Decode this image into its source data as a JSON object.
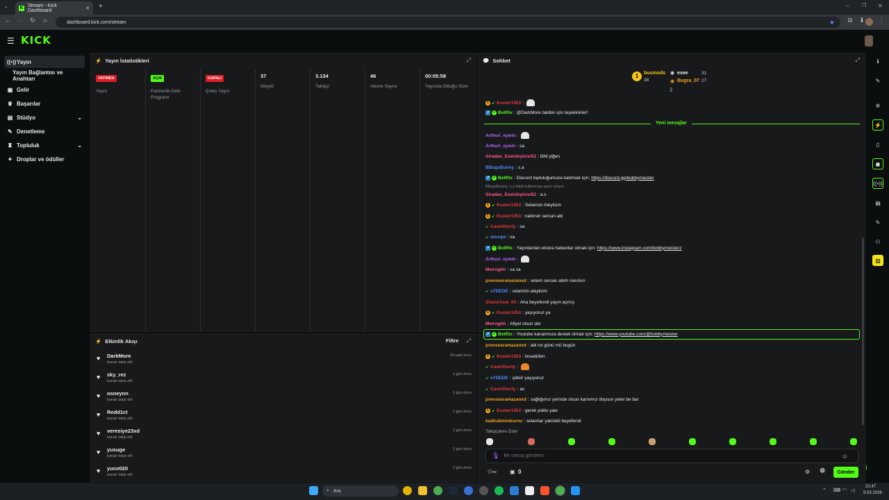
{
  "browser": {
    "tab_title": "Stream - Kick Dashboard",
    "url": "dashboard.kick.com/stream"
  },
  "app": {
    "logo": "KICK"
  },
  "sidebar": {
    "items": [
      {
        "icon": "broadcast-icon",
        "label": "Yayın"
      },
      {
        "icon": "",
        "label": "Yayın Bağlantısı ve Anahtarı"
      },
      {
        "icon": "wallet-icon",
        "label": "Gelir"
      },
      {
        "icon": "trophy-icon",
        "label": "Başarılar"
      },
      {
        "icon": "studio-icon",
        "label": "Stüdyo"
      },
      {
        "icon": "wrench-icon",
        "label": "Denetleme"
      },
      {
        "icon": "community-icon",
        "label": "Topluluk"
      },
      {
        "icon": "gift-icon",
        "label": "Droplar ve ödüller"
      }
    ]
  },
  "stats": {
    "title": "Yayın İstatistikleri",
    "columns": [
      {
        "value": "YAYINDA",
        "label": "Yayın",
        "kind": "badge-red"
      },
      {
        "value": "AÇIK",
        "label": "Partnerlik Gelir Programı",
        "kind": "badge-green"
      },
      {
        "value": "KAPALI",
        "label": "Çoklu Yayın",
        "kind": "badge-red"
      },
      {
        "value": "37",
        "label": "İzleyici",
        "kind": "num"
      },
      {
        "value": "3.134",
        "label": "Takipçi",
        "kind": "num"
      },
      {
        "value": "46",
        "label": "Abone Sayısı",
        "kind": "num"
      },
      {
        "value": "00:05:58",
        "label": "Yayında Olduğu Süre",
        "kind": "num"
      }
    ]
  },
  "activity": {
    "title": "Etkinlik Akışı",
    "filter_label": "Filtre",
    "items": [
      {
        "name": "DarkMore",
        "sub": "kanalı takip etti",
        "time": "19 saat önce"
      },
      {
        "name": "sky_rez",
        "sub": "kanalı takip etti",
        "time": "1 gün önce"
      },
      {
        "name": "osneynn",
        "sub": "kanalı takip etti",
        "time": "1 gün önce"
      },
      {
        "name": "Redd1ct",
        "sub": "kanalı takip etti",
        "time": "1 gün önce"
      },
      {
        "name": "veresiye23xd",
        "sub": "kanalı takip etti",
        "time": "1 gün önce"
      },
      {
        "name": "yusuge",
        "sub": "kanalı takip etti",
        "time": "1 gün önce"
      },
      {
        "name": "yuco020",
        "sub": "kanalı takip etti",
        "time": "1 gün önce"
      }
    ]
  },
  "chat": {
    "title": "Sohbet",
    "top_gifters": [
      {
        "name": "busmods",
        "count": "38"
      },
      {
        "name": "exee",
        "count": "31"
      },
      {
        "name": "Bugra_07",
        "count": "27"
      }
    ],
    "new_messages_label": "Yeni mesajlar",
    "reply_note": "BBugsBunny: s.a ikinil kullanıcıya yanıt veriyor",
    "messages": [
      {
        "user": "Kuster1453",
        "color": "#e33b3b",
        "text": "",
        "emote": true
      },
      {
        "user": "BotRix",
        "color": "#53fc18",
        "text": "@DarkMore takibin için teşekkürler!"
      },
      {
        "user": "Arthuri_eywin",
        "color": "#b36bff",
        "text": "",
        "emote": true
      },
      {
        "user": "Arthuri_eywin",
        "color": "#b36bff",
        "text": "sa"
      },
      {
        "user": "Siradan_Exelzleyicisi52",
        "color": "#ff5c8a",
        "text": "Bitti yiğen"
      },
      {
        "user": "BBugsBunny",
        "color": "#4f8cff",
        "text": "s.a"
      },
      {
        "user": "BotRix",
        "color": "#53fc18",
        "text": "Discord topluluğumuza katılmak için;",
        "link": "https://discord.gg/bobbymeister"
      },
      {
        "user": "Siradan_Exelzleyicisi52",
        "color": "#ff5c8a",
        "text": "a.s"
      },
      {
        "user": "Kuster1453",
        "color": "#e33b3b",
        "text": "Selamün Aleyküm"
      },
      {
        "user": "Kuster1453",
        "color": "#e33b3b",
        "text": "nabirsin sercan abi"
      },
      {
        "user": "CaneShorty",
        "color": "#e33b3b",
        "text": "sa"
      },
      {
        "user": "aresqw",
        "color": "#4f8cff",
        "text": "sa"
      },
      {
        "user": "BotRix",
        "color": "#53fc18",
        "text": "Yayınlardan ekstra haberdar olmak için;",
        "link": "https://www.instagram.com/bobbymeisterz"
      },
      {
        "user": "Arthuri_eywin",
        "color": "#b36bff",
        "text": "",
        "emote": true
      },
      {
        "user": "Meiroghh",
        "color": "#ff5c8a",
        "text": "sa sa"
      },
      {
        "user": "prensesramazanxd",
        "color": "#f5a623",
        "text": "selam sercan abim nasılsın"
      },
      {
        "user": "o7DEDE",
        "color": "#4f8cff",
        "text": "selamün aleyküm"
      },
      {
        "user": "ShaneAsel_00",
        "color": "#e33b3b",
        "text": "Aha beyefendi yayın açmış"
      },
      {
        "user": "Kuster1453",
        "color": "#e33b3b",
        "text": "yaşıyoruz ya"
      },
      {
        "user": "Meiroghh",
        "color": "#ff5c8a",
        "text": "Afiyet olsun abi"
      },
      {
        "user": "BotRix",
        "color": "#53fc18",
        "text": "Youtube kanalımıza destek olmak için;",
        "link": "https://www.youtube.com/@bobbymeister",
        "highlight": true
      },
      {
        "user": "prensesramazanxd",
        "color": "#f5a623",
        "text": "abi rol günü mü bugün"
      },
      {
        "user": "Kuster1453",
        "color": "#e33b3b",
        "text": "tesadüfen"
      },
      {
        "user": "CaneShorty",
        "color": "#e33b3b",
        "text": "",
        "emote": true
      },
      {
        "user": "o7DEDE",
        "color": "#4f8cff",
        "text": "şükür yaşıyoruz"
      },
      {
        "user": "CaneShorty",
        "color": "#e33b3b",
        "text": "as"
      },
      {
        "user": "prensesramazanxd",
        "color": "#f5a623",
        "text": "sağlığımız yerinde olsun karnımız doysun yeter be bai"
      },
      {
        "user": "Kuster1453",
        "color": "#e33b3b",
        "text": "gerek yoktu yaw"
      },
      {
        "user": "kadirabininburnu",
        "color": "#f5a623",
        "text": "selamlar yakisikli beyefendi"
      }
    ],
    "followers_only_label": "Takipçilere Özel",
    "input_placeholder": "Bir mesaj gönderin",
    "points": "0",
    "send_label": "Gönder"
  },
  "taskbar": {
    "search_placeholder": "Ara",
    "time": "21:47",
    "date": "9.03.2026"
  },
  "colors": {
    "accent": "#53fc18",
    "badge_red": "#e01b24",
    "bg": "#0b0e0f",
    "panel": "#18191b"
  }
}
